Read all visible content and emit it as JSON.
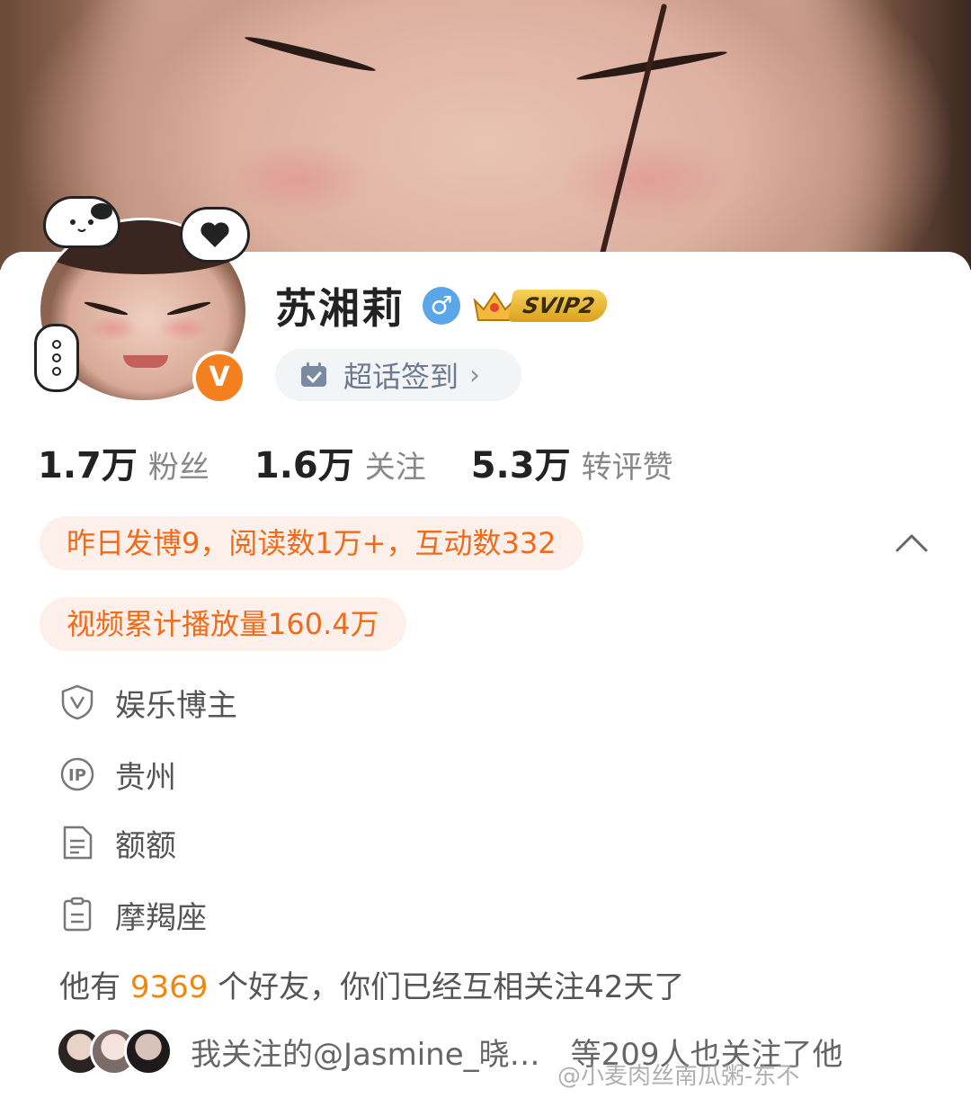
{
  "profile": {
    "name": "苏湘莉",
    "gender_symbol": "♂",
    "vip_label": "SVIP2",
    "verify_symbol": "V",
    "supertopic_label": "超话签到",
    "supertopic_chevron": "›"
  },
  "stats": [
    {
      "value": "1.7万",
      "label": "粉丝"
    },
    {
      "value": "1.6万",
      "label": "关注"
    },
    {
      "value": "5.3万",
      "label": "转评赞"
    }
  ],
  "highlights": {
    "yesterday": "昨日发博9，阅读数1万+，互动数332",
    "video": "视频累计播放量160.4万"
  },
  "info": {
    "category": "娱乐博主",
    "ip_location": "贵州",
    "bio": "额额",
    "zodiac": "摩羯座"
  },
  "friends": {
    "prefix": "他有 ",
    "count": "9369",
    "suffix": " 个好友，你们已经互相关注42天了"
  },
  "mutual": {
    "text": "我关注的@Jasmine_晓…　等209人也关注了他"
  },
  "watermark": "@小麦肉丝南瓜粥-东不",
  "colors": {
    "accent_orange": "#f06a1a",
    "verify_orange": "#f37f1e",
    "gender_blue": "#5aa6e8"
  },
  "icons": [
    "verified-v-icon",
    "gender-male-icon",
    "crown-icon",
    "calendar-check-icon",
    "chevron-right-icon",
    "chevron-up-icon",
    "shield-v-icon",
    "ip-icon",
    "document-icon",
    "clipboard-icon"
  ]
}
